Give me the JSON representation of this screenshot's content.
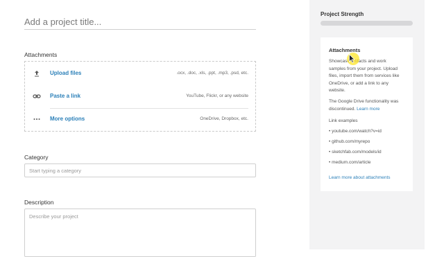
{
  "project": {
    "title_placeholder": "Add a project title..."
  },
  "attachments": {
    "label": "Attachments",
    "rows": [
      {
        "label": "Upload files",
        "hint": ".ocx, .doc, .xls, .ppt, .mp3, .psd, etc.",
        "icon": "upload-icon"
      },
      {
        "label": "Paste a link",
        "hint": "YouTube, Flickr, or any website",
        "icon": "link-icon"
      },
      {
        "label": "More options",
        "hint": "OneDrive, Dropbox, etc.",
        "icon": "more-icon"
      }
    ]
  },
  "category": {
    "label": "Category",
    "placeholder": "Start typing a category"
  },
  "description": {
    "label": "Description",
    "placeholder": "Describe your project"
  },
  "sidebar": {
    "strength_label": "Project Strength",
    "strength_value": 0,
    "card": {
      "title": "Attachments",
      "body": "Showcase artifacts and work samples from your project. Upload files, import them from services like OneDrive, or add a link to any website.",
      "notice_text": "The Google Drive functionality was discontinued.",
      "notice_link": "Learn more",
      "examples_label": "Link examples",
      "examples": [
        "youtube.com/watch?v=id",
        "github.com/myrepo",
        "sketchfab.com/models/id",
        "medium.com/article"
      ],
      "learn_more": "Learn more about attachments"
    }
  },
  "colors": {
    "link": "#2a7fb8",
    "sidebar_bg": "#f3f3f4",
    "bar_bg": "#d7d7d9"
  }
}
